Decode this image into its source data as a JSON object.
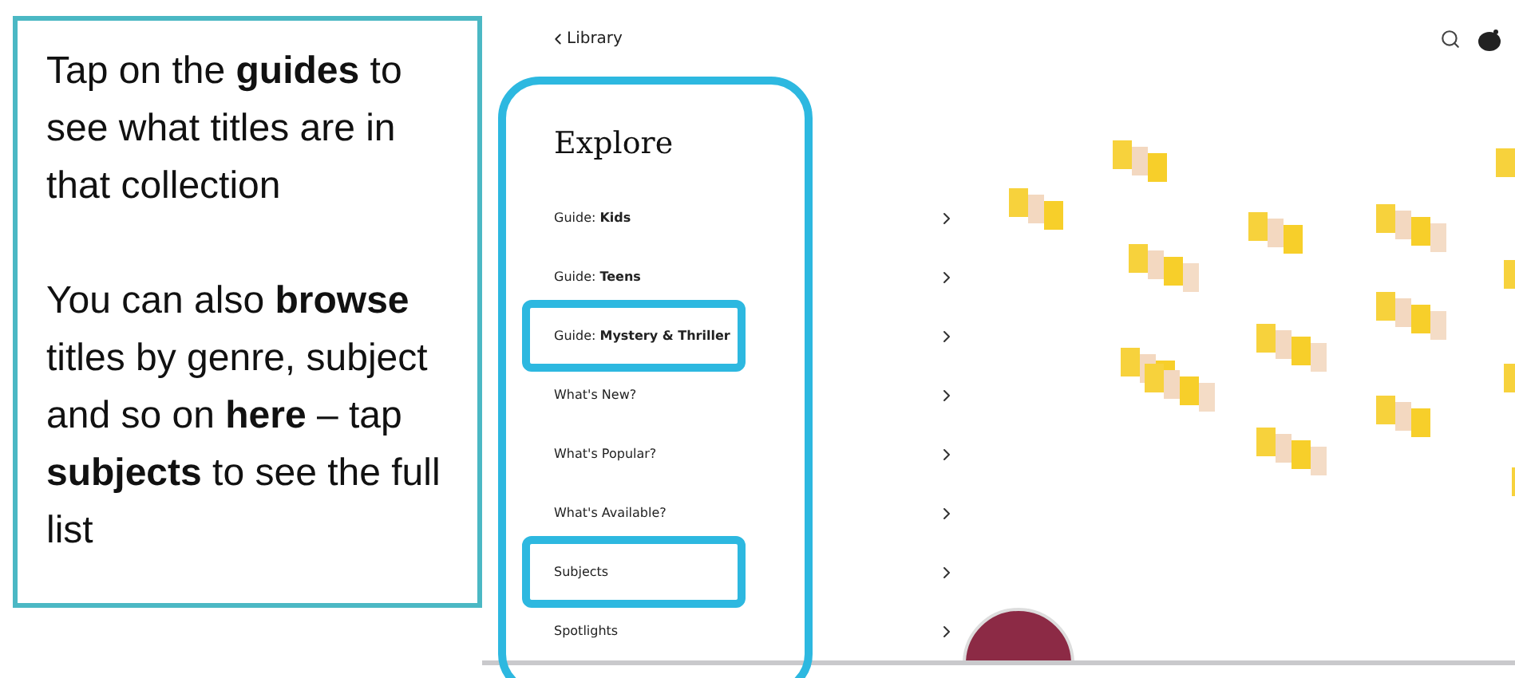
{
  "callout": {
    "paragraphs": [
      "Tap on the **guides** to see what titles are in that collection",
      "You can also **browse** titles by genre, subject and so on **here** – tap **subjects** to see the full list"
    ]
  },
  "top_bar": {
    "back_label": "Library"
  },
  "explore": {
    "title": "Explore",
    "outlined": true,
    "items": [
      {
        "label": "Guide: **Kids**",
        "highlighted": false
      },
      {
        "label": "Guide: **Teens**",
        "highlighted": false
      },
      {
        "label": "Guide: **Mystery & Thriller**",
        "highlighted": true
      },
      {
        "label": "What's New?",
        "highlighted": false
      },
      {
        "label": "What's Popular?",
        "highlighted": false
      },
      {
        "label": "What's Available?",
        "highlighted": false
      },
      {
        "label": "Subjects",
        "highlighted": true
      },
      {
        "label": "Spotlights",
        "highlighted": false
      }
    ]
  }
}
